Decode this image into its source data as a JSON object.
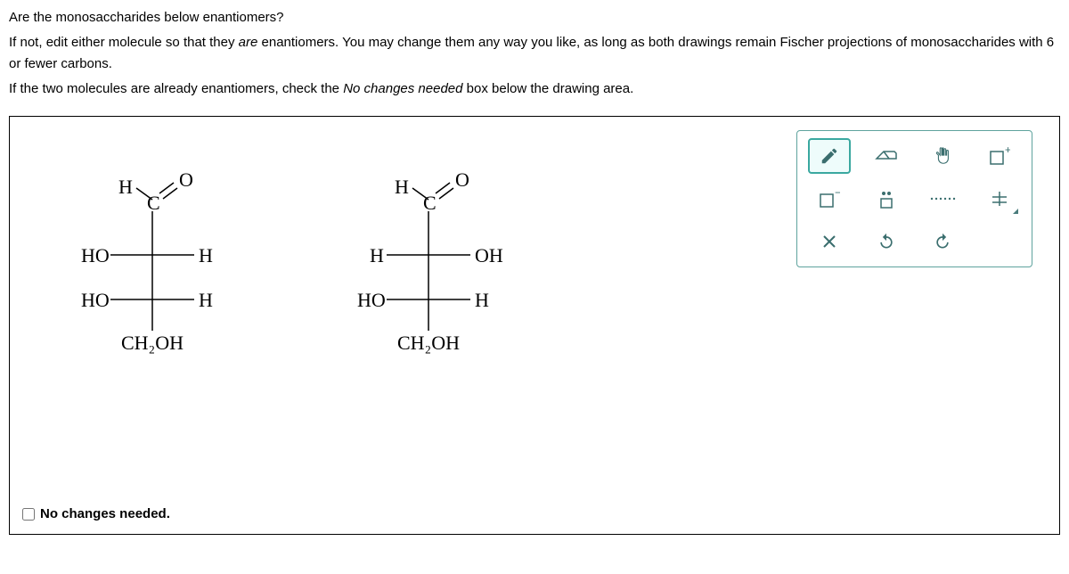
{
  "question": {
    "line1": "Are the monosaccharides below enantiomers?",
    "line2a": "If not, edit either molecule so that they ",
    "line2italic": "are",
    "line2b": " enantiomers. You may change them any way you like, as long as both drawings remain Fischer projections of monosaccharides with 6 or fewer carbons.",
    "line3a": "If the two molecules are already enantiomers, check the ",
    "line3italic": "No changes needed",
    "line3b": " box below the drawing area."
  },
  "molecule1": {
    "topH": "H",
    "topO": "O",
    "topC": "C",
    "row1left": "HO",
    "row1right": "H",
    "row2left": "HO",
    "row2right": "H",
    "bottom": "CH₂OH"
  },
  "molecule2": {
    "topH": "H",
    "topO": "O",
    "topC": "C",
    "row1left": "H",
    "row1right": "OH",
    "row2left": "HO",
    "row2right": "H",
    "bottom": "CH₂OH"
  },
  "checkbox": {
    "label": "No changes needed."
  },
  "tools": {
    "pencil": "✎",
    "eraser": "⌫",
    "hand": "✋",
    "plus": "+",
    "minus": "−",
    "dots": "••",
    "bond": "······",
    "struct": "⧾",
    "close": "✕",
    "undo": "↶",
    "redo": "↷"
  }
}
